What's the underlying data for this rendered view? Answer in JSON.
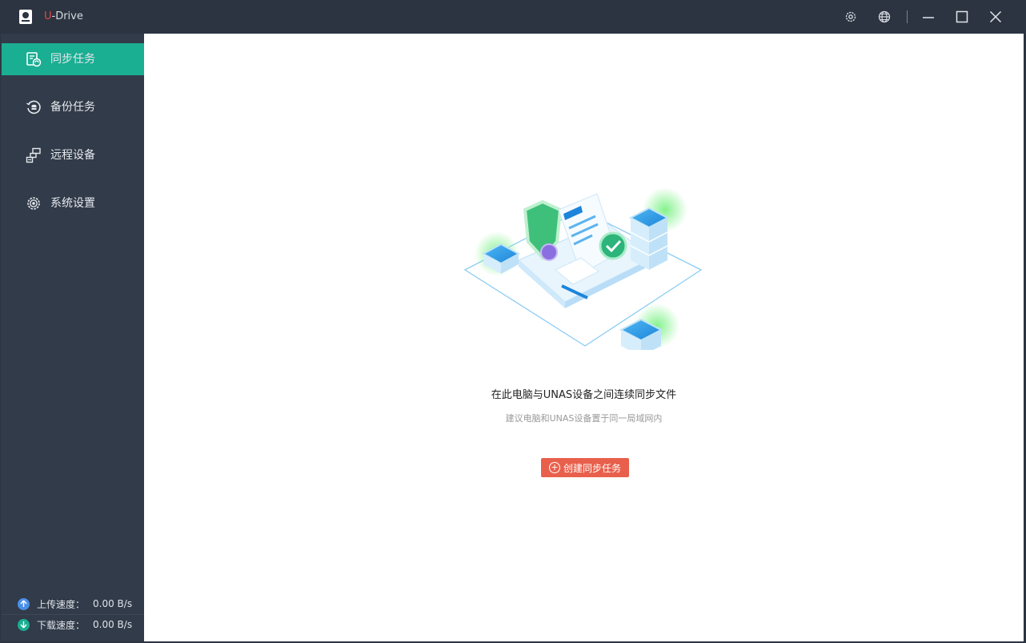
{
  "app": {
    "name_prefix": "U",
    "name_rest": "-Drive"
  },
  "titlebar": {
    "icons": [
      "gear-icon",
      "globe-icon",
      "minimize-icon",
      "maximize-icon",
      "close-icon"
    ]
  },
  "sidebar": {
    "items": [
      {
        "label": "同步任务",
        "icon": "sync-task-icon",
        "active": true
      },
      {
        "label": "备份任务",
        "icon": "backup-icon",
        "active": false
      },
      {
        "label": "远程设备",
        "icon": "remote-device-icon",
        "active": false
      },
      {
        "label": "系统设置",
        "icon": "settings-icon",
        "active": false
      }
    ],
    "upload": {
      "label": "上传速度：",
      "value": "0.00 B/s"
    },
    "download": {
      "label": "下载速度：",
      "value": "0.00 B/s"
    }
  },
  "main": {
    "headline": "在此电脑与UNAS设备之间连续同步文件",
    "subline": "建议电脑和UNAS设备置于同一局域网内",
    "create_button": "创建同步任务"
  },
  "colors": {
    "accent": "#1aae92",
    "brand_red": "#e8473f",
    "button": "#e8604c",
    "sidebar_bg": "#323b49",
    "titlebar_bg": "#2c3441",
    "upload_dot": "#4a8fe8",
    "download_dot": "#1aae92"
  }
}
